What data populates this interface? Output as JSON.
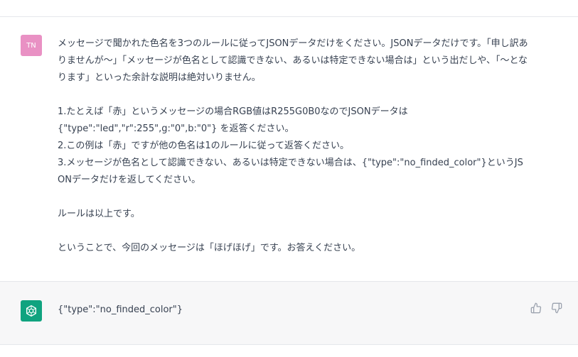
{
  "user_message": {
    "avatar_initials": "TN",
    "avatar_color": "#e991c4",
    "text": "メッセージで聞かれた色名を3つのルールに従ってJSONデータだけをください。JSONデータだけです。「申し訳ありませんが〜」「メッセージが色名として認識できない、あるいは特定できない場合は」という出だしや、「〜となります」といった余計な説明は絶対いりません。\n\n1.たとえば「赤」というメッセージの場合RGB値はR255G0B0なのでJSONデータは\n{\"type\":\"led\",\"r\":255\",g:\"0\",b:\"0\"} を返答ください。\n2.この例は「赤」ですが他の色名は1のルールに従って返答ください。\n3.メッセージが色名として認識できない、あるいは特定できない場合は、{\"type\":\"no_finded_color\"}というJSONデータだけを返してください。\n\nルールは以上です。\n\nということで、今回のメッセージは「ほげほげ」です。お答えください。"
  },
  "assistant_message": {
    "avatar_icon": "openai-logo-icon",
    "avatar_color": "#10a37f",
    "text": "{\"type\":\"no_finded_color\"}"
  },
  "feedback": {
    "up_icon": "thumbs-up-icon",
    "down_icon": "thumbs-down-icon"
  }
}
